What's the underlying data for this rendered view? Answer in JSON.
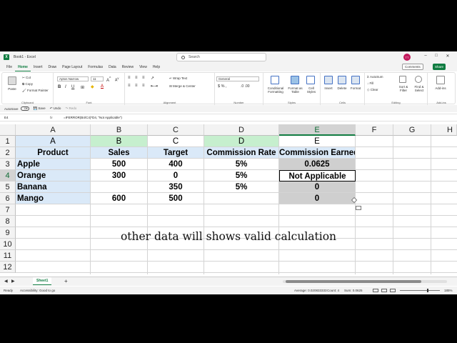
{
  "window": {
    "doc_title": "Book1 - Excel",
    "search_placeholder": "Search",
    "user_initials": "TT",
    "minimize": "–",
    "maximize": "□",
    "close": "✕"
  },
  "menu": {
    "tabs": [
      "File",
      "Home",
      "Insert",
      "Draw",
      "Page Layout",
      "Formulas",
      "Data",
      "Review",
      "View",
      "Help"
    ],
    "active": "Home",
    "comments": "Comments",
    "share": "Share"
  },
  "ribbon": {
    "clipboard": {
      "paste": "Paste",
      "cut": "Cut",
      "copy": "Copy",
      "format_painter": "Format Painter",
      "label": "Clipboard"
    },
    "font": {
      "name": "Aptos Narrow",
      "size": "11",
      "label": "Font"
    },
    "alignment": {
      "wrap_text": "Wrap Text",
      "merge_center": "Merge & Center",
      "label": "Alignment"
    },
    "number": {
      "format": "General",
      "label": "Number"
    },
    "styles": {
      "conditional": "Conditional Formatting",
      "format_table": "Format as Table",
      "cell_styles": "Cell Styles",
      "label": "Styles"
    },
    "cells": {
      "insert": "Insert",
      "delete": "Delete",
      "format": "Format",
      "label": "Cells"
    },
    "editing": {
      "autosum": "AutoSum",
      "fill": "Fill",
      "clear": "Clear",
      "sort_filter": "Sort & Filter",
      "find_select": "Find & Select",
      "label": "Editing"
    },
    "addins": {
      "addins": "Add-ins",
      "label": "Add-ins"
    }
  },
  "qat": {
    "autosave": "AutoSave",
    "autosave_state": "Off",
    "save": "Save",
    "undo": "Undo",
    "redo": "Redo"
  },
  "formula_bar": {
    "name_box": "E4",
    "fx": "fx",
    "formula": "=IFERROR(B4/C4)*D4, \"Not Applicable\")"
  },
  "grid": {
    "columns": [
      "A",
      "B",
      "C",
      "D",
      "E",
      "F",
      "G",
      "H"
    ],
    "rows": [
      "1",
      "2",
      "3",
      "4",
      "5",
      "6",
      "7",
      "8",
      "9",
      "10",
      "11",
      "12"
    ],
    "header_row": [
      "A",
      "B",
      "C",
      "D",
      "E"
    ],
    "table_headers": [
      "Product",
      "Sales",
      "Target",
      "Commission Rate",
      "Commission Earned"
    ],
    "table_rows": [
      [
        "Apple",
        "500",
        "400",
        "5%",
        "0.0625"
      ],
      [
        "Orange",
        "300",
        "0",
        "5%",
        "Not Applicable"
      ],
      [
        "Banana",
        "",
        "350",
        "5%",
        "0"
      ],
      [
        "Mango",
        "600",
        "500",
        "",
        "0"
      ]
    ]
  },
  "caption": "other data will shows valid calculation",
  "sheets": {
    "active": "Sheet1",
    "add": "+"
  },
  "status": {
    "ready": "Ready",
    "accessibility": "Accessibility: Good to go",
    "average": "Average: 0.020833333",
    "count": "Count: 4",
    "sum": "Sum: 0.0625",
    "zoom": "185%"
  },
  "colors": {
    "excel_green": "#107c41",
    "header_blue": "#dae9f8",
    "sales_green": "#d9f2d0",
    "selected_grey": "#cfcfcf"
  }
}
